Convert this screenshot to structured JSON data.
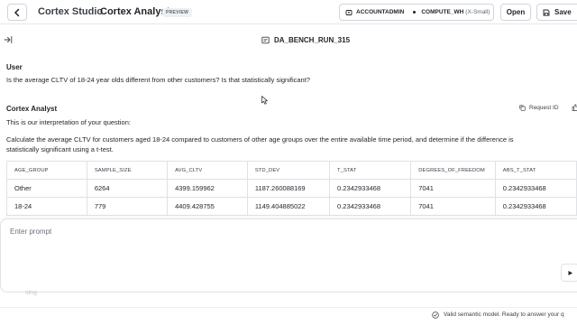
{
  "header": {
    "brand": "Cortex Studio",
    "app_title": "Cortex Analyst",
    "badge": "PREVIEW",
    "role": "ACCOUNTADMIN",
    "warehouse": "COMPUTE_WH",
    "warehouse_size": "(X-Small)",
    "open_label": "Open",
    "save_label": "Save"
  },
  "run": {
    "title": "DA_BENCH_RUN_315"
  },
  "conversation": {
    "user_label": "User",
    "user_question": "Is the average CLTV of 18-24 year olds different from other customers? Is that statistically significant?",
    "analyst_label": "Cortex Analyst",
    "request_id_label": "Request ID",
    "interpretation_intro": "This is our interpretation of your question:",
    "interpretation_line1": "Calculate the average CLTV for customers aged 18-24 compared to customers of other age groups over the entire available time period, and determine if the difference is",
    "interpretation_line2": "statistically significant using a t-test."
  },
  "table": {
    "columns": [
      "AGE_GROUP",
      "SAMPLE_SIZE",
      "AVG_CLTV",
      "STD_DEV",
      "T_STAT",
      "DEGREES_OF_FREEDOM",
      "ABS_T_STAT"
    ],
    "rows": [
      [
        "Other",
        "6264",
        "4399.159962",
        "1187.260088169",
        "0.2342933468",
        "7041",
        "0.2342933468"
      ],
      [
        "18-24",
        "779",
        "4409.428755",
        "1149.404885022",
        "0.2342933468",
        "7041",
        "0.2342933468"
      ]
    ]
  },
  "prompt": {
    "placeholder": "Enter prompt",
    "faded_text": "sing"
  },
  "status": {
    "text": "Valid semantic model. Ready to answer your q"
  },
  "colors": {
    "border": "#dfe2e6",
    "text": "#1f2328",
    "muted": "#5e6670"
  }
}
